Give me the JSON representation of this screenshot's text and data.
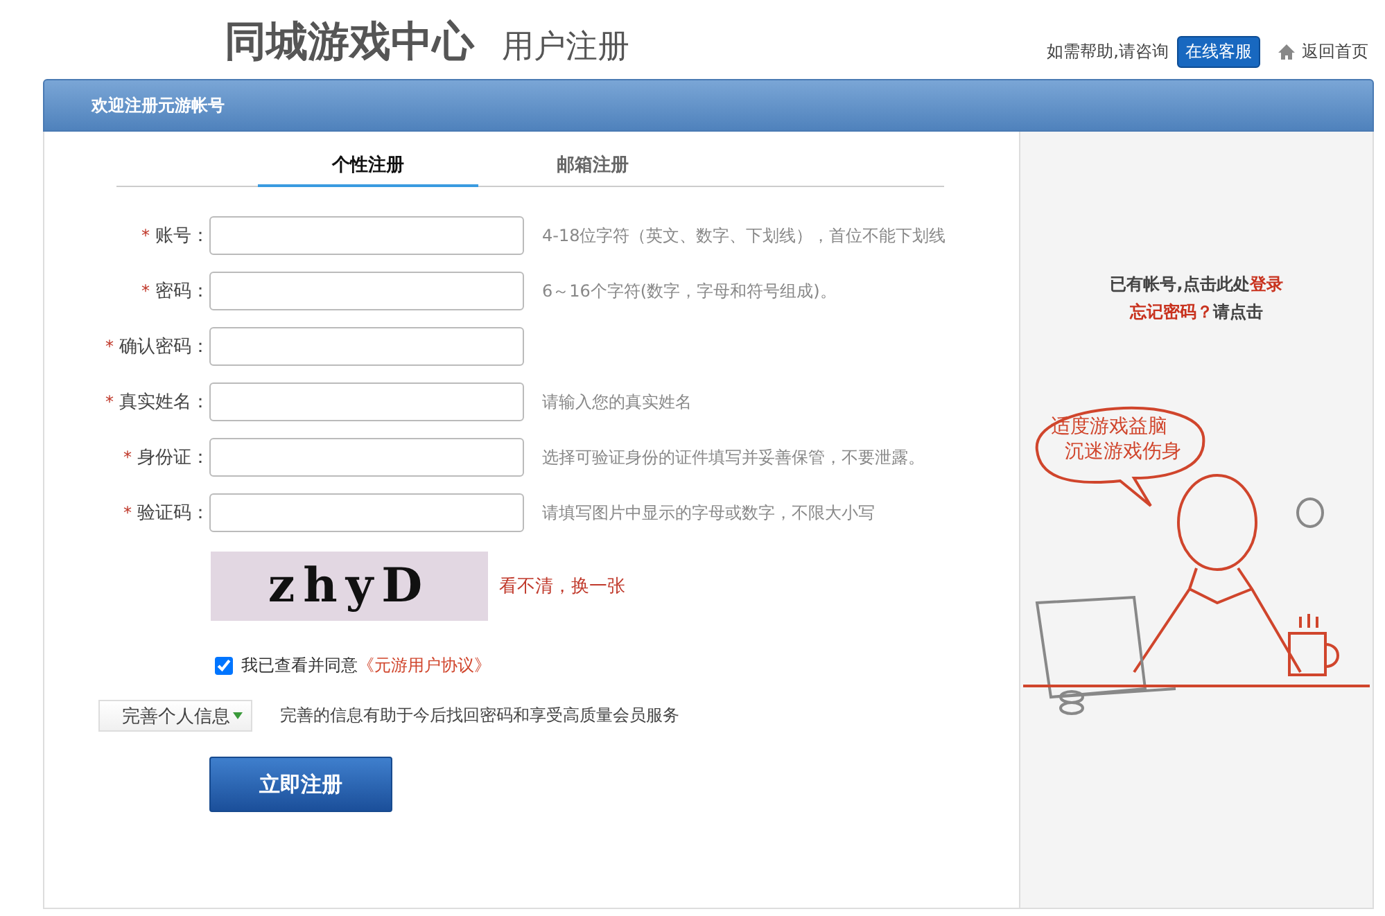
{
  "header": {
    "title": "同城游戏中心",
    "subtitle": "用户注册",
    "help_text": "如需帮助,请咨询",
    "service_button": "在线客服",
    "home_link": "返回首页"
  },
  "banner": {
    "title": "欢迎注册元游帐号"
  },
  "tabs": [
    {
      "label": "个性注册",
      "selected": true
    },
    {
      "label": "邮箱注册",
      "selected": false
    }
  ],
  "fields": [
    {
      "required": "*",
      "label": "账号：",
      "hint": "4-18位字符（英文、数字、下划线），首位不能下划线"
    },
    {
      "required": "*",
      "label": "密码：",
      "hint": "6～16个字符(数字，字母和符号组成)。"
    },
    {
      "required": "*",
      "label": "确认密码："
    },
    {
      "required": "*",
      "label": "真实姓名：",
      "hint": "请输入您的真实姓名"
    },
    {
      "required": "*",
      "label": "身份证：",
      "hint": "选择可验证身份的证件填写并妥善保管，不要泄露。"
    },
    {
      "required": "*",
      "label": "验证码：",
      "hint": "请填写图片中显示的字母或数字，不限大小写"
    }
  ],
  "captcha": {
    "text": "zhyD",
    "refresh_link": "看不清，换一张"
  },
  "agreement": {
    "checked": true,
    "text": "我已查看并同意",
    "link": "《元游用户协议》"
  },
  "more_info": {
    "button": "完善个人信息",
    "note": "完善的信息有助于今后找回密码和享受高质量会员服务"
  },
  "submit": "立即注册",
  "sidebar": {
    "login_prefix": "已有帐号,点击此处",
    "login_link": "登录",
    "forgot_link": "忘记密码？",
    "forgot_suffix": "请点击",
    "bubble_lines": [
      "适度游戏益脑",
      "沉迷游戏伤身"
    ]
  }
}
